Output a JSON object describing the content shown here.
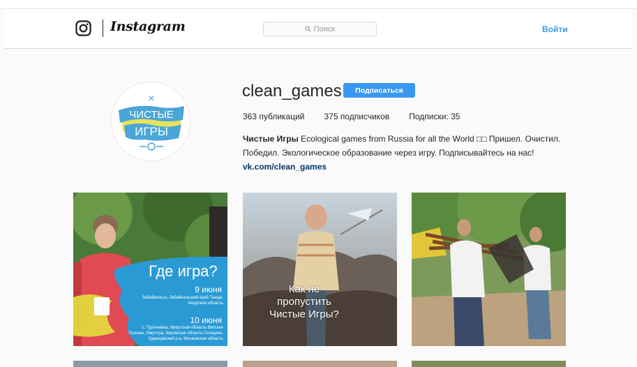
{
  "nav": {
    "wordmark": "Instagram",
    "search_placeholder": "Поиск",
    "login_label": "Войти"
  },
  "profile": {
    "username": "clean_games",
    "follow_label": "Подписаться",
    "posts": "363 публикаций",
    "followers": "375 подписчиков",
    "following": "Подписки: 35",
    "bio_name": "Чистые Игры",
    "bio_text": " Ecological games from Russia for all the World □□ Пришел. Очистил. Победил. Экологическое образование через игру. Подписывайтесь на нас!",
    "bio_link": "vk.com/clean_games",
    "avatar_text": [
      "ЧИСТЫЕ",
      "ИГРЫ"
    ]
  },
  "posts": {
    "p1": {
      "headline": "Где игра?",
      "date1": "9 июня",
      "places1": "Забайкальск, Забайкальский край Тында, Амурская область",
      "date2": "10 июня",
      "places2": "с. Тургеневка, Иркутская область Вятские Поляны, Омутора, Кировская область Голицино, Одинцовский р-н, Московская область"
    },
    "p2": {
      "caption": "Как не пропустить Чистые Игры?"
    }
  },
  "colors": {
    "accent": "#3897f0",
    "link": "#003569"
  }
}
